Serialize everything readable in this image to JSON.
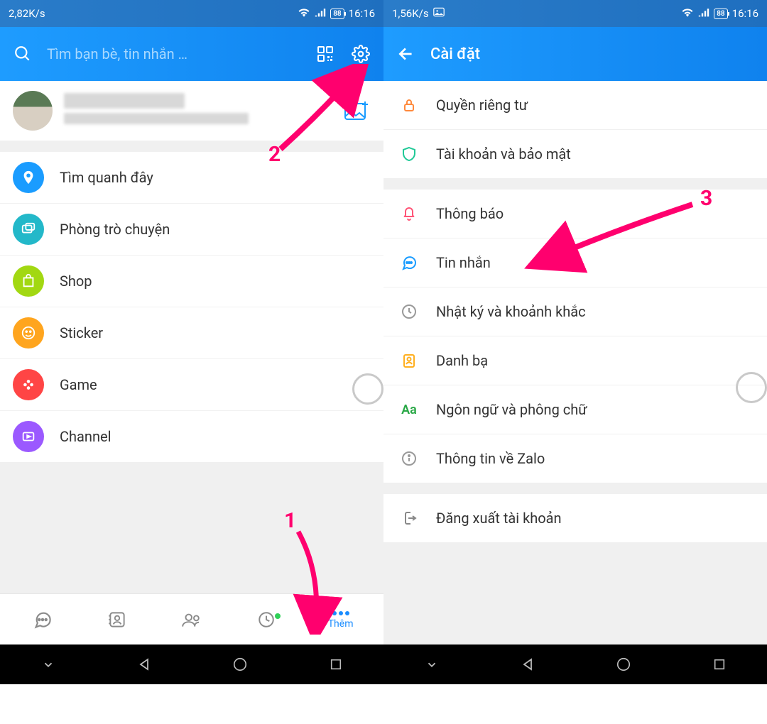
{
  "left": {
    "status": {
      "speed": "2,82K/s",
      "battery": "88",
      "time": "16:16"
    },
    "search_placeholder": "Tìm bạn bè, tin nhắn …",
    "menu": [
      {
        "label": "Tìm quanh đây",
        "color": "#1a9cff",
        "icon": "location-pin-icon"
      },
      {
        "label": "Phòng trò chuyện",
        "color": "#23b8c9",
        "icon": "chat-bubbles-icon"
      },
      {
        "label": "Shop",
        "color": "#a2d812",
        "icon": "shop-bag-icon"
      },
      {
        "label": "Sticker",
        "color": "#ffa51e",
        "icon": "smile-icon"
      },
      {
        "label": "Game",
        "color": "#ff4545",
        "icon": "gamepad-icon"
      },
      {
        "label": "Channel",
        "color": "#9b59ff",
        "icon": "tv-icon"
      }
    ],
    "nav_more_label": "Thêm"
  },
  "right": {
    "status": {
      "speed": "1,56K/s",
      "battery": "88",
      "time": "16:16"
    },
    "title": "Cài đặt",
    "group1": [
      {
        "label": "Quyền riêng tư",
        "icon": "lock-icon",
        "color": "#ff8a3d"
      },
      {
        "label": "Tài khoản và bảo mật",
        "icon": "shield-icon",
        "color": "#20c997"
      }
    ],
    "group2": [
      {
        "label": "Thông báo",
        "icon": "bell-icon",
        "color": "#ff5577"
      },
      {
        "label": "Tin nhắn",
        "icon": "message-icon",
        "color": "#1a9cff"
      },
      {
        "label": "Nhật ký và khoảnh khắc",
        "icon": "clock-icon",
        "color": "#999"
      },
      {
        "label": "Danh bạ",
        "icon": "contact-icon",
        "color": "#ffb020"
      },
      {
        "label": "Ngôn ngữ và phông chữ",
        "icon": "font-icon",
        "color": "#28a745",
        "text": "Aa"
      },
      {
        "label": "Thông tin về Zalo",
        "icon": "info-icon",
        "color": "#999"
      }
    ],
    "group3": [
      {
        "label": "Đăng xuất tài khoản",
        "icon": "logout-icon",
        "color": "#888"
      }
    ]
  },
  "annotations": {
    "a1": "1",
    "a2": "2",
    "a3": "3"
  }
}
